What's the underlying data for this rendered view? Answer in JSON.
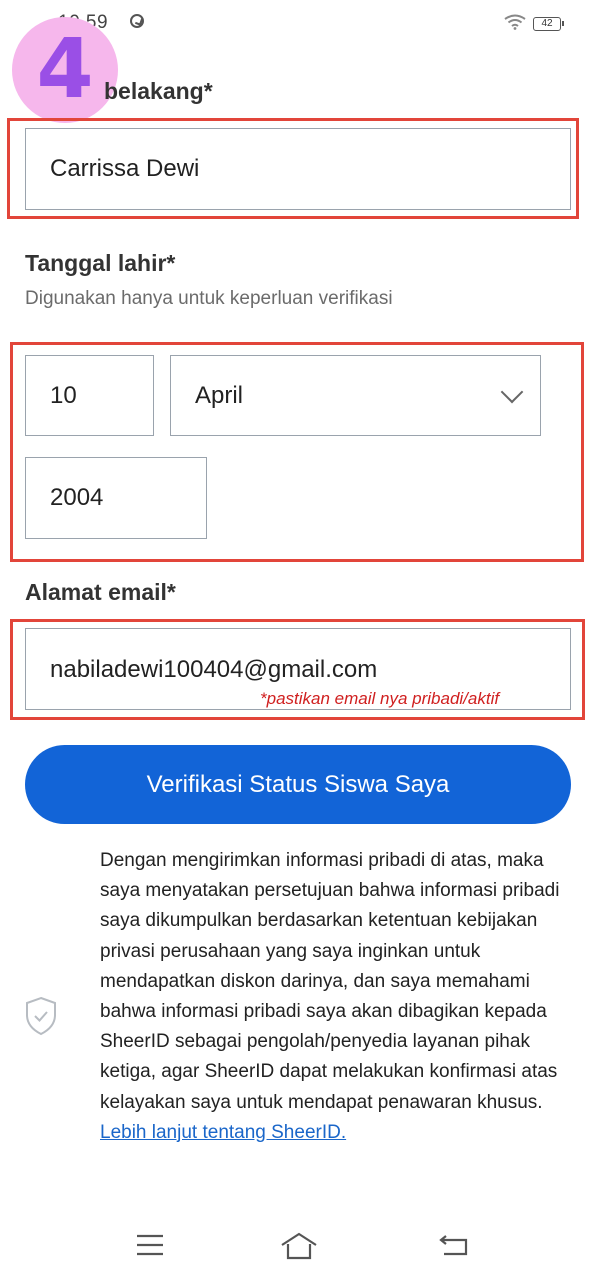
{
  "status_bar": {
    "time": "10.59",
    "battery": "42"
  },
  "step_badge": "4",
  "last_name": {
    "label": "Nama belakang*",
    "visible_label": "belakang*",
    "value": "Carrissa Dewi"
  },
  "birth_date": {
    "label": "Tanggal lahir*",
    "hint": "Digunakan hanya untuk keperluan verifikasi",
    "day": "10",
    "month": "April",
    "year": "2004"
  },
  "email": {
    "label": "Alamat email*",
    "value": "nabiladewi100404@gmail.com",
    "note": "*pastikan email nya pribadi/aktif"
  },
  "submit_button": "Verifikasi Status Siswa Saya",
  "consent": {
    "text": "Dengan mengirimkan informasi pribadi di atas, maka saya menyatakan persetujuan bahwa informasi pribadi saya dikumpulkan berdasarkan ketentuan kebijakan privasi perusahaan yang saya inginkan untuk mendapatkan diskon darinya, dan saya memahami bahwa informasi pribadi saya akan dibagikan kepada SheerID sebagai pengolah/penyedia layanan pihak ketiga, agar SheerID dapat melakukan konfirmasi atas kelayakan saya untuk mendapat penawaran khusus.",
    "link": "Lebih lanjut tentang SheerID."
  },
  "colors": {
    "primary": "#1264d7",
    "annotation_red": "#e2453a",
    "badge_pink": "#f6b7ec",
    "badge_purple": "#9a4fe6"
  },
  "icons": [
    "sync-icon",
    "wifi-icon",
    "battery-icon",
    "chevron-down-icon",
    "shield-check-icon",
    "menu-icon",
    "home-icon",
    "back-icon"
  ]
}
